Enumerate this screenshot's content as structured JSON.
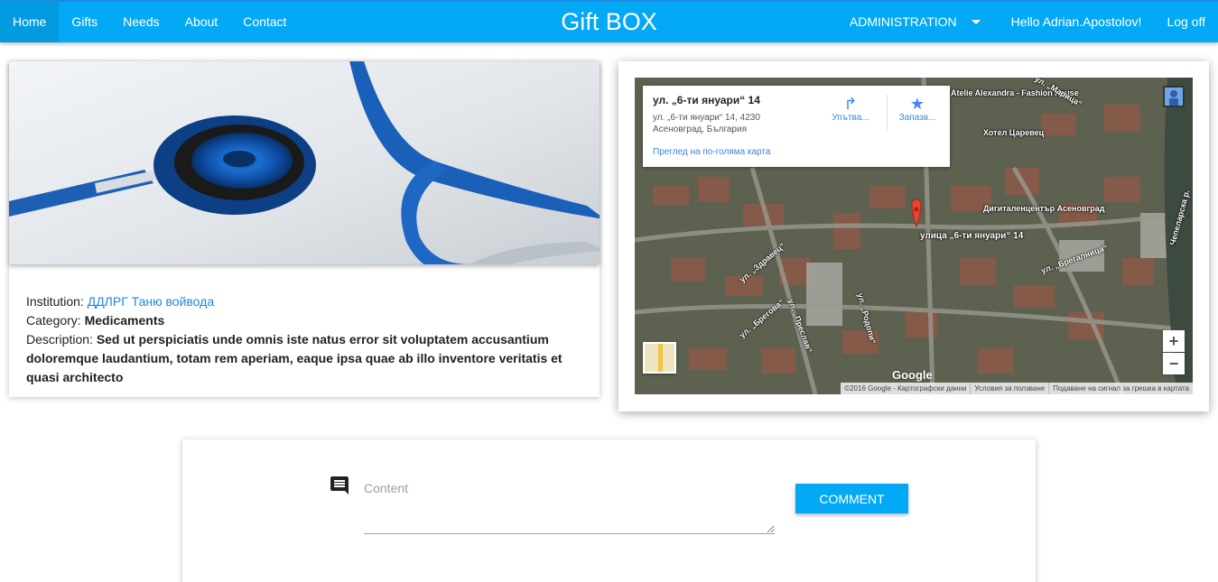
{
  "nav": {
    "items": [
      {
        "label": "Home",
        "active": true
      },
      {
        "label": "Gifts"
      },
      {
        "label": "Needs"
      },
      {
        "label": "About"
      },
      {
        "label": "Contact"
      }
    ],
    "brand": "Gift BOX",
    "admin_label": "ADMINISTRATION",
    "greeting": "Hello Adrian.Apostolov!",
    "logoff_label": "Log off",
    "color": "#03a9f4"
  },
  "need": {
    "institution_label": "Institution:",
    "institution_value": "ДДЛРГ Таню войвода",
    "category_label": "Category:",
    "category_value": "Medicaments",
    "description_label": "Description:",
    "description_value": "Sed ut perspiciatis unde omnis iste natus error sit voluptatem accusantium doloremque laudantium, totam rem aperiam, eaque ipsa quae ab illo inventore veritatis et quasi architecto"
  },
  "map": {
    "popup_title": "ул. „6-ти януари“ 14",
    "popup_address_line1": "ул. „6-ти януари“ 14, 4230",
    "popup_address_line2": "Асеновград, България",
    "popup_link": "Преглед на по-голяма карта",
    "directions_label": "Упътва...",
    "save_label": "Запазв...",
    "marker_label": "улица „6-ти януари“ 14",
    "zoom_in": "+",
    "zoom_out": "−",
    "google_logo": "Google",
    "footer": [
      "©2016 Google - Картографски данни",
      "Условия за ползване",
      "Подаване на сигнал за грешка в картата"
    ],
    "streets": [
      "Atelie Alexandra - Fashion house",
      "Хотел Царевец",
      "Дигиталенцентър Асеновград",
      "ул. „Здравец“",
      "ул. „Брегова“",
      "ул. „Преслав“",
      "ул. „Родопи“",
      "ул. „Брегалница“",
      "ул. „Марица“",
      "Чепеларска р."
    ]
  },
  "comment": {
    "placeholder": "Content",
    "button_label": "Comment"
  }
}
